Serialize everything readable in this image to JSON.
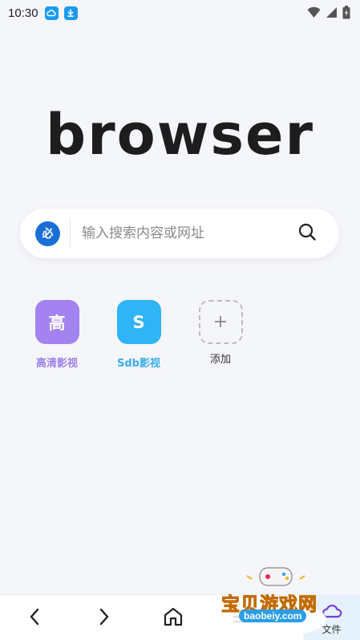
{
  "status_bar": {
    "time": "10:30",
    "left_icons": [
      "cloud-app-icon",
      "download-app-icon"
    ],
    "right_icons": [
      "wifi-icon",
      "signal-icon",
      "battery-icon"
    ]
  },
  "logo": {
    "text": "browser"
  },
  "search": {
    "engine_badge": "必",
    "placeholder": "输入搜索内容或网址",
    "value": ""
  },
  "shortcuts": [
    {
      "icon_text": "高",
      "label": "高清影视",
      "color": "#a383f0",
      "label_color": "#9c7fe8"
    },
    {
      "icon_text": "S",
      "label": "Sdb影视",
      "color": "#2fb4f5",
      "label_color": "#3aaee8"
    }
  ],
  "add_shortcut": {
    "icon_text": "+",
    "label": "添加"
  },
  "bottom_nav": {
    "items": [
      "back-icon",
      "forward-icon",
      "home-icon",
      "menu-icon"
    ],
    "file_label": "文件"
  },
  "watermark": {
    "title": "宝贝游戏网",
    "url": "baobeiy.com"
  },
  "colors": {
    "background": "#f5f6fa",
    "accent": "#1a6fd6"
  }
}
